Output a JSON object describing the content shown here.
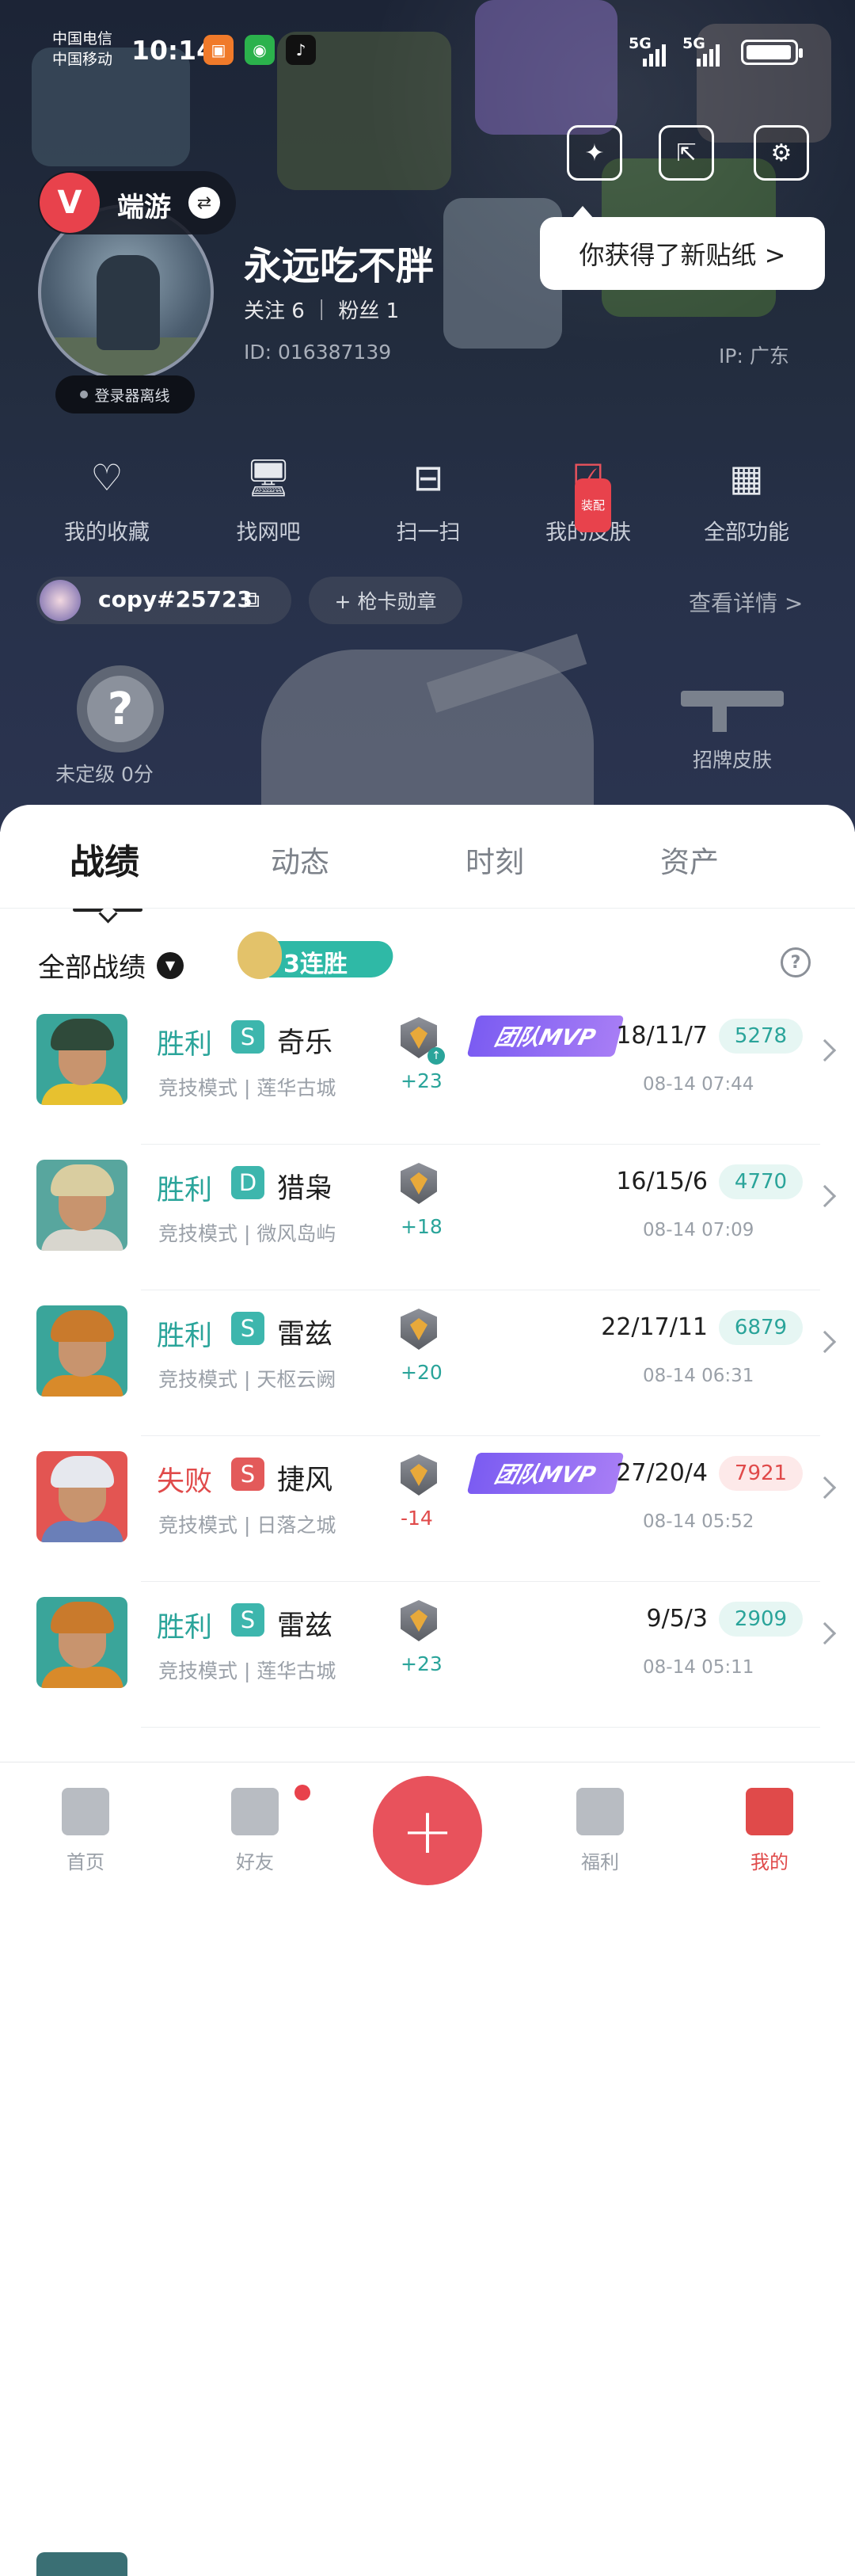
{
  "status_bar": {
    "carrier1": "中国电信",
    "carrier2": "中国移动",
    "time": "10:14",
    "sig1": "5G",
    "sig2": "5G",
    "app_icons": [
      "app-icon-orange",
      "wechat-icon",
      "tiktok-icon"
    ]
  },
  "header": {
    "game_badge": "端游",
    "game_logo": "V",
    "username": "永远吃不胖",
    "follow_label": "关注 6 ｜ 粉丝 1",
    "uid": "ID: 016387139",
    "ip": "IP: 广东",
    "login_status": "登录器离线",
    "tooltip": "你获得了新贴纸 >"
  },
  "functions": [
    {
      "label": "我的收藏",
      "icon": "♡"
    },
    {
      "label": "找网吧",
      "icon": "🖥"
    },
    {
      "label": "扫一扫",
      "icon": "⊟"
    },
    {
      "label": "我的皮肤",
      "icon": "☑",
      "badge": "装配"
    },
    {
      "label": "全部功能",
      "icon": "▦"
    }
  ],
  "riot_id": "copy#25723",
  "card_badge_label": "+ 枪卡勋章",
  "detail_link": "查看详情 >",
  "rank_label": "未定级 0分",
  "rank_symbol": "?",
  "skin_label": "招牌皮肤",
  "tabs": [
    "战绩",
    "动态",
    "时刻",
    "资产"
  ],
  "filter_label": "全部战绩",
  "streak_label": "3连胜",
  "matches": [
    {
      "result": "胜利",
      "outcome": "win",
      "tier": "S",
      "hero": "奇乐",
      "mode": "竞技模式 | 莲华古城",
      "delta": "+23",
      "rankup": true,
      "mvp": "团队MVP",
      "kda": "18/11/7",
      "score": "5278",
      "time": "08-14 07:44",
      "hair": "#2f4a3a",
      "bg": "#3aa59a",
      "shoulder": "#e7c12f"
    },
    {
      "result": "胜利",
      "outcome": "win",
      "tier": "D",
      "hero": "猎枭",
      "mode": "竞技模式 | 微风岛屿",
      "delta": "+18",
      "rankup": false,
      "mvp": "",
      "kda": "16/15/6",
      "score": "4770",
      "time": "08-14 07:09",
      "hair": "#d9cda0",
      "bg": "#58a69e",
      "shoulder": "#d8d6ce"
    },
    {
      "result": "胜利",
      "outcome": "win",
      "tier": "S",
      "hero": "雷兹",
      "mode": "竞技模式 | 天枢云阙",
      "delta": "+20",
      "rankup": false,
      "mvp": "",
      "kda": "22/17/11",
      "score": "6879",
      "time": "08-14 06:31",
      "hair": "#c97a2c",
      "bg": "#3aa59a",
      "shoulder": "#d88a2a"
    },
    {
      "result": "失败",
      "outcome": "lose",
      "tier": "S",
      "hero": "捷风",
      "mode": "竞技模式 | 日落之城",
      "delta": "-14",
      "rankup": false,
      "mvp": "团队MVP",
      "kda": "27/20/4",
      "score": "7921",
      "time": "08-14 05:52",
      "hair": "#e6e8ee",
      "bg": "#e35552",
      "shoulder": "#6a7fb8"
    },
    {
      "result": "胜利",
      "outcome": "win",
      "tier": "S",
      "hero": "雷兹",
      "mode": "竞技模式 | 莲华古城",
      "delta": "+23",
      "rankup": false,
      "mvp": "",
      "kda": "9/5/3",
      "score": "2909",
      "time": "08-14 05:11",
      "hair": "#c97a2c",
      "bg": "#3aa59a",
      "shoulder": "#d88a2a"
    }
  ],
  "nav": [
    "首页",
    "好友",
    "福利",
    "我的"
  ],
  "fab_symbol": "+"
}
